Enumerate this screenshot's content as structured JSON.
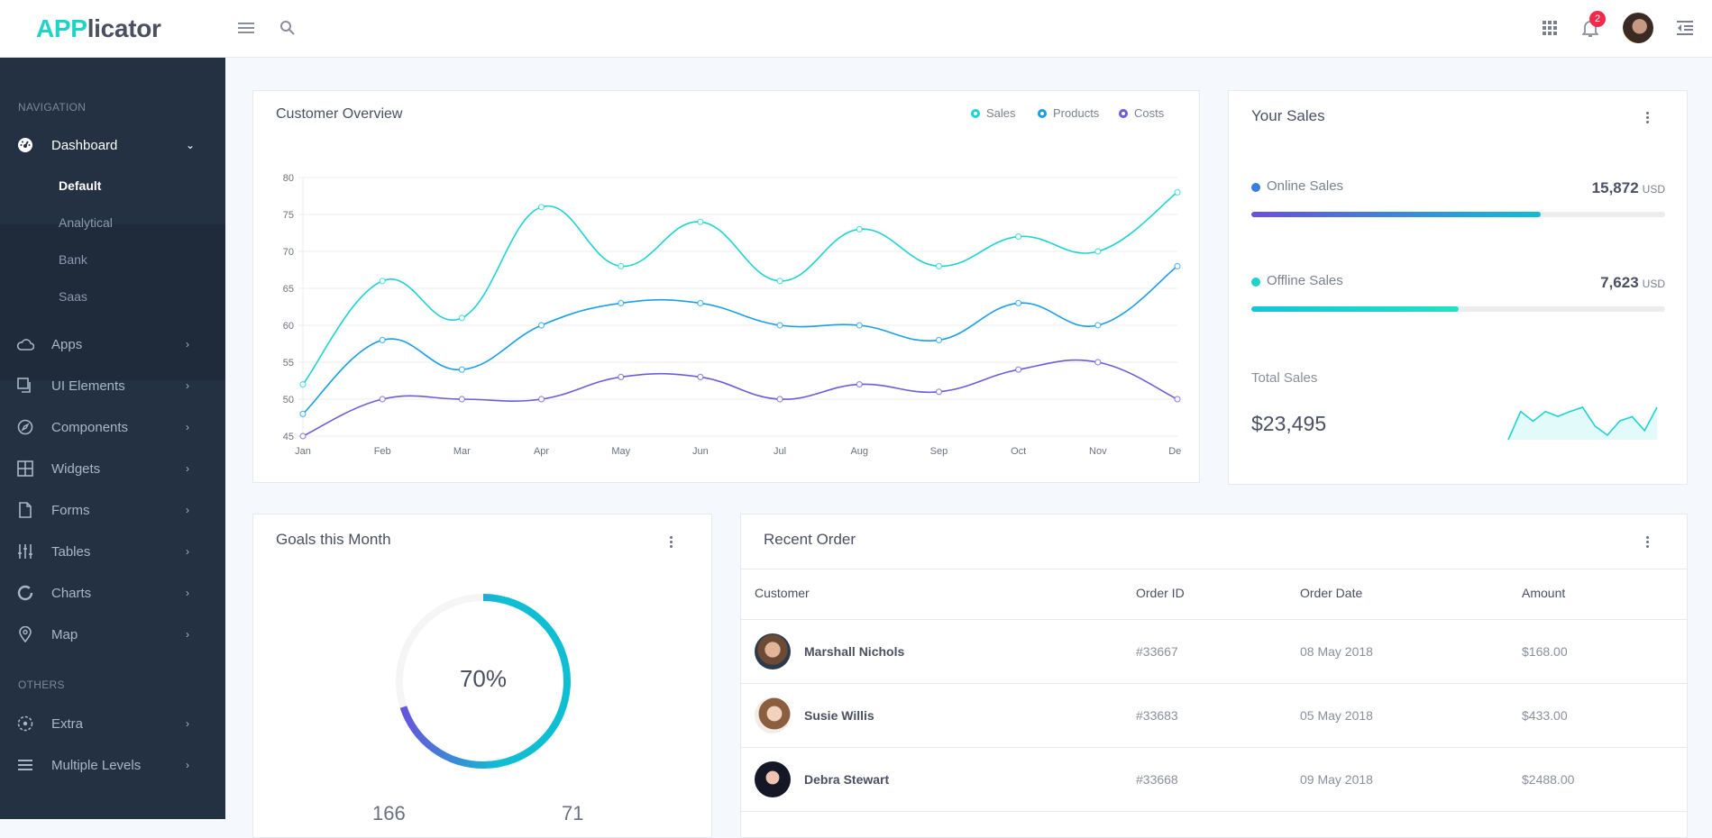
{
  "header": {
    "logo_prefix": "APP",
    "logo_suffix": "licator",
    "notification_count": "2",
    "icons": [
      "menu-icon",
      "search-icon",
      "apps-grid-icon",
      "bell-icon",
      "user-avatar",
      "right-panel-toggle-icon"
    ]
  },
  "sidebar": {
    "nav_heading": "NAVIGATION",
    "dashboard": {
      "label": "Dashboard",
      "icon": "gauge-icon",
      "chevron": "⌄"
    },
    "dashboard_sub": [
      {
        "label": "Default",
        "active": true
      },
      {
        "label": "Analytical"
      },
      {
        "label": "Bank"
      },
      {
        "label": "Saas"
      }
    ],
    "items": [
      {
        "label": "Apps",
        "icon": "cloud-icon"
      },
      {
        "label": "UI Elements",
        "icon": "copy-icon"
      },
      {
        "label": "Components",
        "icon": "compass-icon"
      },
      {
        "label": "Widgets",
        "icon": "grid-icon"
      },
      {
        "label": "Forms",
        "icon": "file-icon"
      },
      {
        "label": "Tables",
        "icon": "sliders-icon"
      },
      {
        "label": "Charts",
        "icon": "donut-icon"
      },
      {
        "label": "Map",
        "icon": "map-pin-icon"
      }
    ],
    "others_heading": "OTHERS",
    "others": [
      {
        "label": "Extra",
        "icon": "target-icon"
      },
      {
        "label": "Multiple Levels",
        "icon": "list-icon"
      }
    ],
    "chevron": "›"
  },
  "customer_overview": {
    "title": "Customer Overview"
  },
  "chart_data": {
    "type": "line",
    "title": "Customer Overview",
    "xlabel": "",
    "ylabel": "",
    "categories": [
      "Jan",
      "Feb",
      "Mar",
      "Apr",
      "May",
      "Jun",
      "Jul",
      "Aug",
      "Sep",
      "Oct",
      "Nov",
      "Dec"
    ],
    "ylim": [
      45,
      80
    ],
    "yticks": [
      45,
      50,
      55,
      60,
      65,
      70,
      75,
      80
    ],
    "grid": true,
    "legend_position": "top-right",
    "series": [
      {
        "name": "Sales",
        "color": "#1fd3d0",
        "values": [
          52,
          66,
          61,
          76,
          68,
          74,
          66,
          73,
          68,
          72,
          70,
          78
        ]
      },
      {
        "name": "Products",
        "color": "#1a9ee8",
        "values": [
          48,
          58,
          54,
          60,
          63,
          63,
          60,
          60,
          58,
          63,
          60,
          68
        ]
      },
      {
        "name": "Costs",
        "color": "#6a5ddb",
        "values": [
          45,
          50,
          50,
          50,
          53,
          53,
          50,
          52,
          51,
          54,
          55,
          50
        ]
      }
    ]
  },
  "your_sales": {
    "title": "Your Sales",
    "online": {
      "label": "Online Sales",
      "value": "15,872",
      "unit": "USD",
      "progress_pct": 70,
      "dot_color": "#3b7ddd"
    },
    "offline": {
      "label": "Offline Sales",
      "value": "7,623",
      "unit": "USD",
      "progress_pct": 50,
      "dot_color": "#1fd3c6"
    },
    "total_label": "Total Sales",
    "total_value": "$23,495",
    "sparkline_relative": [
      0,
      87,
      57,
      87,
      72,
      87,
      100,
      42,
      14,
      58,
      71,
      28,
      100
    ]
  },
  "goals": {
    "title": "Goals this Month",
    "percent_label": "70%",
    "percent": 70,
    "stat_left": "166",
    "stat_right": "71"
  },
  "recent_order": {
    "title": "Recent Order",
    "columns": [
      "Customer",
      "Order ID",
      "Order Date",
      "Amount"
    ],
    "rows": [
      {
        "customer": "Marshall Nichols",
        "order_id": "#33667",
        "date": "08 May 2018",
        "amount": "$168.00"
      },
      {
        "customer": "Susie Willis",
        "order_id": "#33683",
        "date": "05 May 2018",
        "amount": "$433.00"
      },
      {
        "customer": "Debra Stewart",
        "order_id": "#33668",
        "date": "09 May 2018",
        "amount": "$2488.00"
      }
    ]
  }
}
